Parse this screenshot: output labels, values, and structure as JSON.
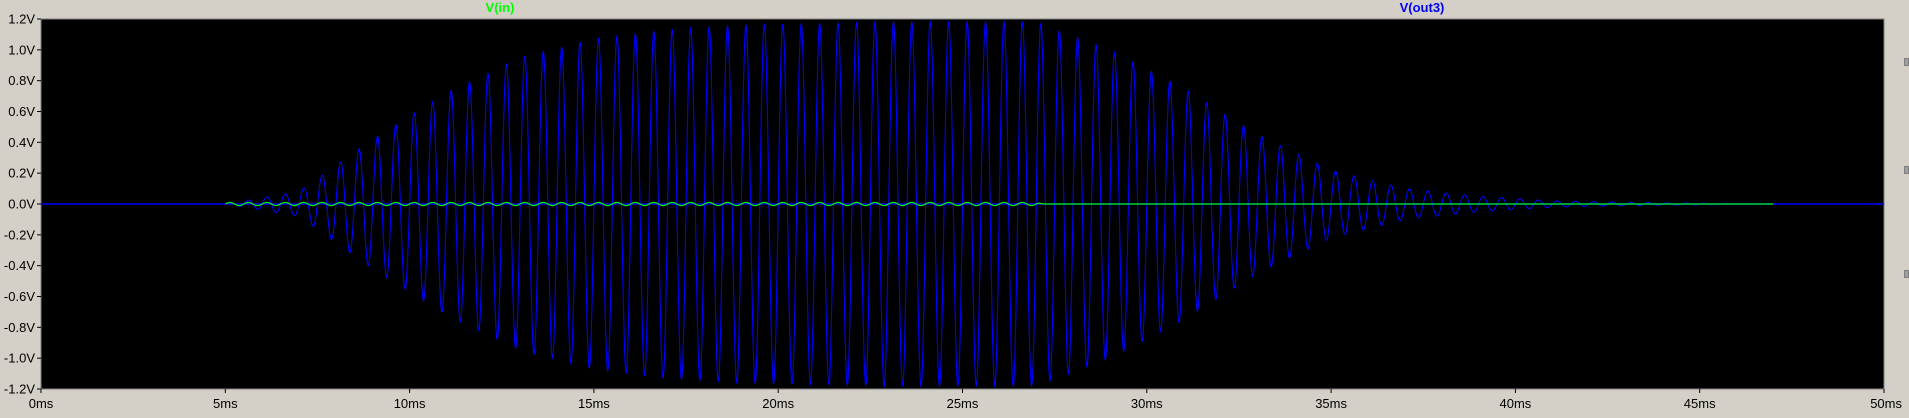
{
  "chart_data": {
    "type": "line",
    "title": "",
    "xlabel": "",
    "ylabel": "",
    "x_unit": "ms",
    "y_unit": "V",
    "xlim": [
      0,
      50
    ],
    "ylim": [
      -1.2,
      1.2
    ],
    "x_ticks": [
      "0ms",
      "5ms",
      "10ms",
      "15ms",
      "20ms",
      "25ms",
      "30ms",
      "35ms",
      "40ms",
      "45ms",
      "50ms"
    ],
    "y_ticks": [
      "1.2V",
      "1.0V",
      "0.8V",
      "0.6V",
      "0.4V",
      "0.2V",
      "0.0V",
      "-0.2V",
      "-0.4V",
      "-0.6V",
      "-0.8V",
      "-1.0V",
      "-1.2V"
    ],
    "series": [
      {
        "name": "V(in)",
        "color": "#00ff00",
        "signal": "sine burst",
        "start_ms": 5,
        "end_ms": 47,
        "envelope": {
          "t": [
            5,
            27,
            27.2,
            47
          ],
          "amplitude": [
            0.01,
            0.01,
            0.0,
            0.0
          ]
        }
      },
      {
        "name": "V(out3)",
        "color": "#0000ff",
        "signal": "sine burst",
        "start_ms": 5,
        "end_ms": 47,
        "envelope": {
          "t": [
            5,
            7,
            9,
            11,
            13,
            15,
            17,
            19,
            21,
            23,
            25,
            27,
            29,
            31,
            33,
            35,
            37,
            39,
            41,
            43,
            45,
            47
          ],
          "amplitude": [
            0.0,
            0.08,
            0.42,
            0.72,
            0.95,
            1.07,
            1.13,
            1.16,
            1.17,
            1.18,
            1.18,
            1.18,
            1.0,
            0.75,
            0.45,
            0.22,
            0.1,
            0.05,
            0.02,
            0.01,
            0.005,
            0.0
          ]
        },
        "cycles_per_ms": 2
      }
    ],
    "grid": false,
    "background": "#000000",
    "zero_line": true,
    "legend": "top"
  }
}
